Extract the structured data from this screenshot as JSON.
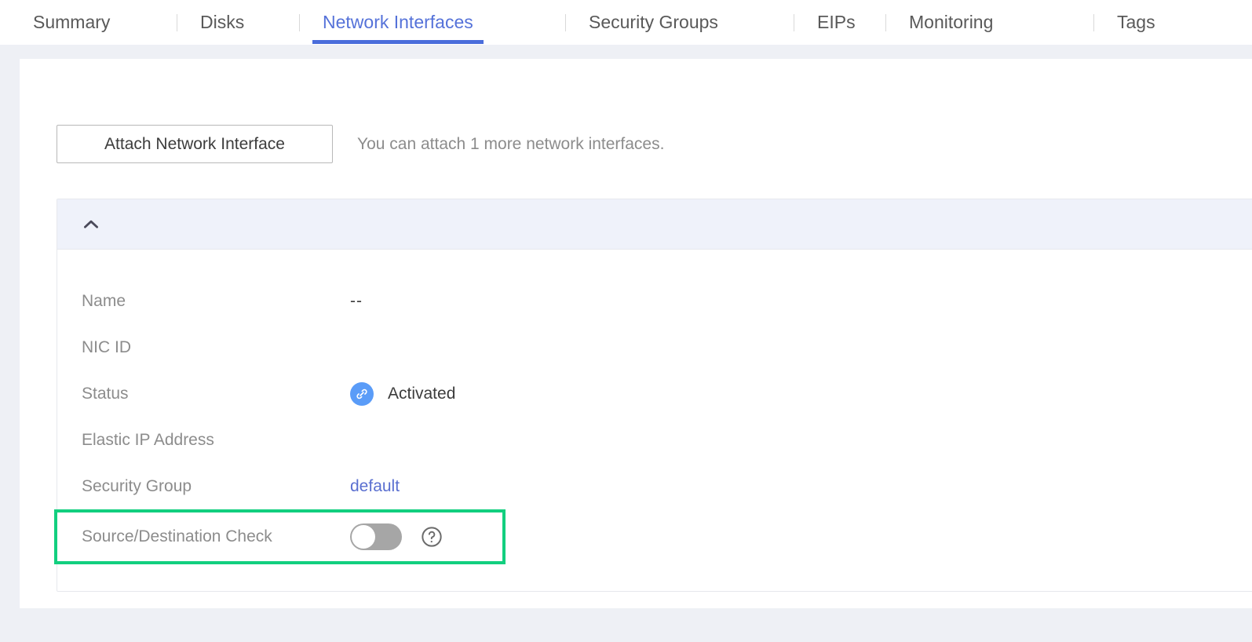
{
  "tabs": [
    {
      "label": "Summary",
      "active": false
    },
    {
      "label": "Disks",
      "active": false
    },
    {
      "label": "Network Interfaces",
      "active": true
    },
    {
      "label": "Security Groups",
      "active": false
    },
    {
      "label": "EIPs",
      "active": false
    },
    {
      "label": "Monitoring",
      "active": false
    },
    {
      "label": "Tags",
      "active": false
    }
  ],
  "toolbar": {
    "attach_button_label": "Attach Network Interface",
    "hint_text": "You can attach 1 more network interfaces."
  },
  "panel": {
    "collapse_icon": "chevron-up-icon",
    "expanded": true,
    "rows": [
      {
        "label": "Name",
        "value": "--",
        "type": "text"
      },
      {
        "label": "NIC ID",
        "value": "",
        "type": "text"
      },
      {
        "label": "Status",
        "value": "Activated",
        "type": "status",
        "icon": "link-circle-icon",
        "icon_color": "#5a9cf8"
      },
      {
        "label": "Elastic IP Address",
        "value": "",
        "type": "text"
      },
      {
        "label": "Security Group",
        "value": "default",
        "type": "link"
      },
      {
        "label": "Source/Destination Check",
        "value": "",
        "type": "toggle",
        "toggle_on": false,
        "help_icon": "question-circle-icon",
        "highlighted": true
      }
    ]
  },
  "colors": {
    "accent_blue": "#4a6ddb",
    "link_blue": "#5a6fd0",
    "status_blue": "#5a9cf8",
    "highlight_green": "#12cf7f",
    "page_bg": "#eef0f5",
    "panel_header_bg": "#eff2fa",
    "toggle_off": "#a6a6a6",
    "label_gray": "#8c8c8c"
  }
}
